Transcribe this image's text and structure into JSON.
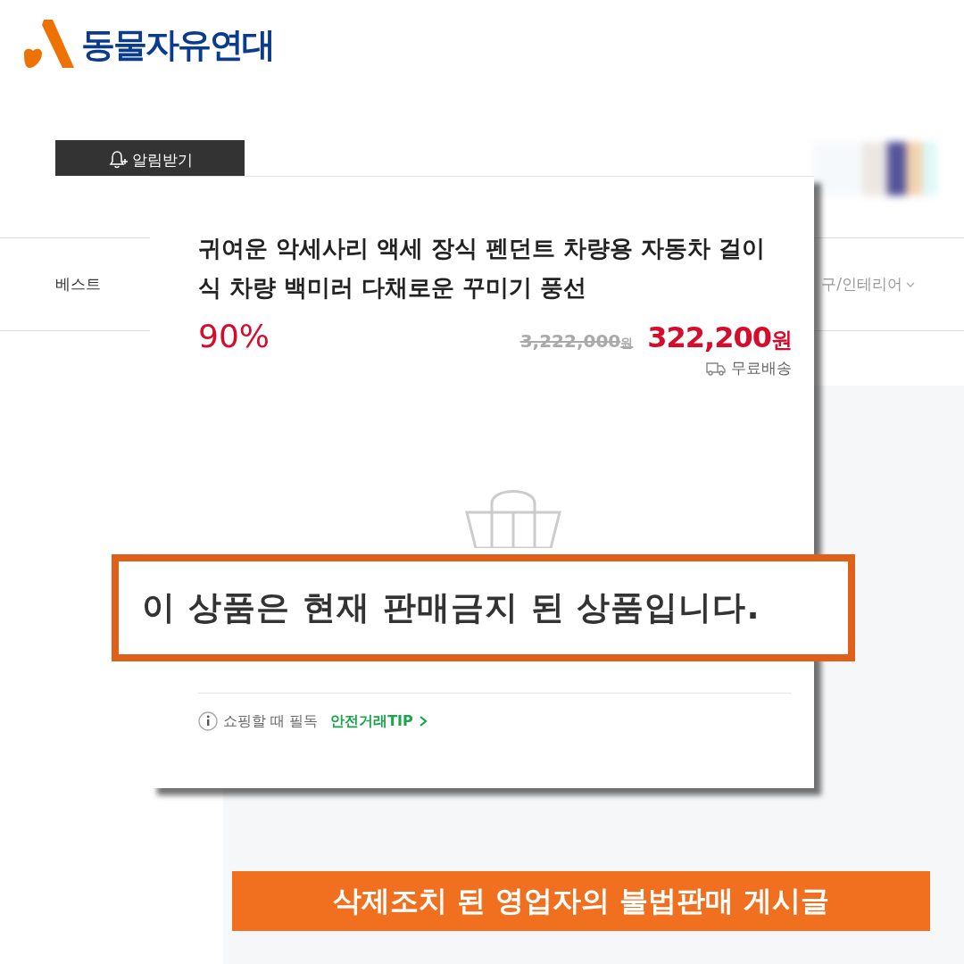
{
  "logo": {
    "name": "동물자유연대"
  },
  "background_page": {
    "alert_button": {
      "label": "알림받기"
    },
    "nav": [
      {
        "label": "베스트"
      },
      {
        "label": "구/인테리어"
      }
    ]
  },
  "product_card": {
    "title": "귀여운 악세사리 액세 장식 펜던트 차량용 자동차 걸이식 차량 백미러 다채로운 꾸미기 풍선",
    "discount": "90%",
    "original_price": "3,222,000",
    "original_currency": "원",
    "sale_price": "322,200",
    "currency": "원",
    "shipping": "무료배송",
    "notice": "이 상품은 현재 판매금지 된 상품입니다.",
    "tip": {
      "text": "쇼핑할 때 필독",
      "link": "안전거래TIP"
    }
  },
  "caption": "삭제조치 된 영업자의 불법판매 게시글"
}
